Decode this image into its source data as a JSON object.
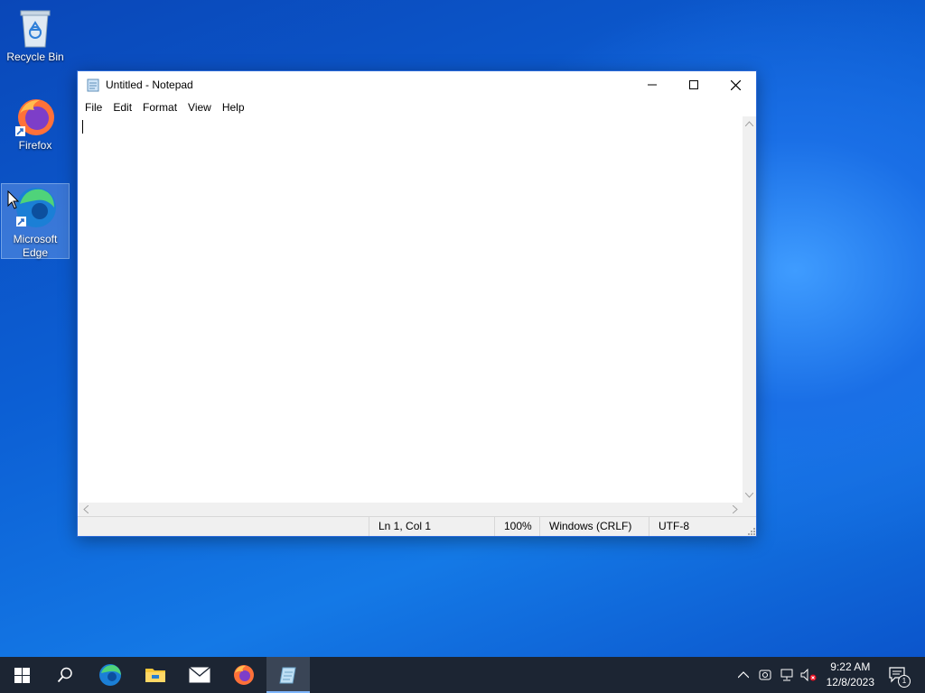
{
  "desktop": {
    "icons": [
      {
        "label": "Recycle Bin"
      },
      {
        "label": "Firefox"
      },
      {
        "label": "Microsoft Edge"
      }
    ]
  },
  "notepad": {
    "title": "Untitled - Notepad",
    "menu": [
      "File",
      "Edit",
      "Format",
      "View",
      "Help"
    ],
    "content": "",
    "status": {
      "position": "Ln 1, Col 1",
      "zoom": "100%",
      "line_ending": "Windows (CRLF)",
      "encoding": "UTF-8"
    }
  },
  "taskbar": {
    "items": [
      "start",
      "search",
      "edge",
      "file-explorer",
      "mail",
      "firefox",
      "notepad"
    ],
    "active": "notepad",
    "clock": {
      "time": "9:22 AM",
      "date": "12/8/2023"
    },
    "notification_count": "1"
  },
  "colors": {
    "taskbar_bg": "#1c2533",
    "window_border": "#2b6ad8",
    "desktop_accent": "#0c5fd4"
  }
}
